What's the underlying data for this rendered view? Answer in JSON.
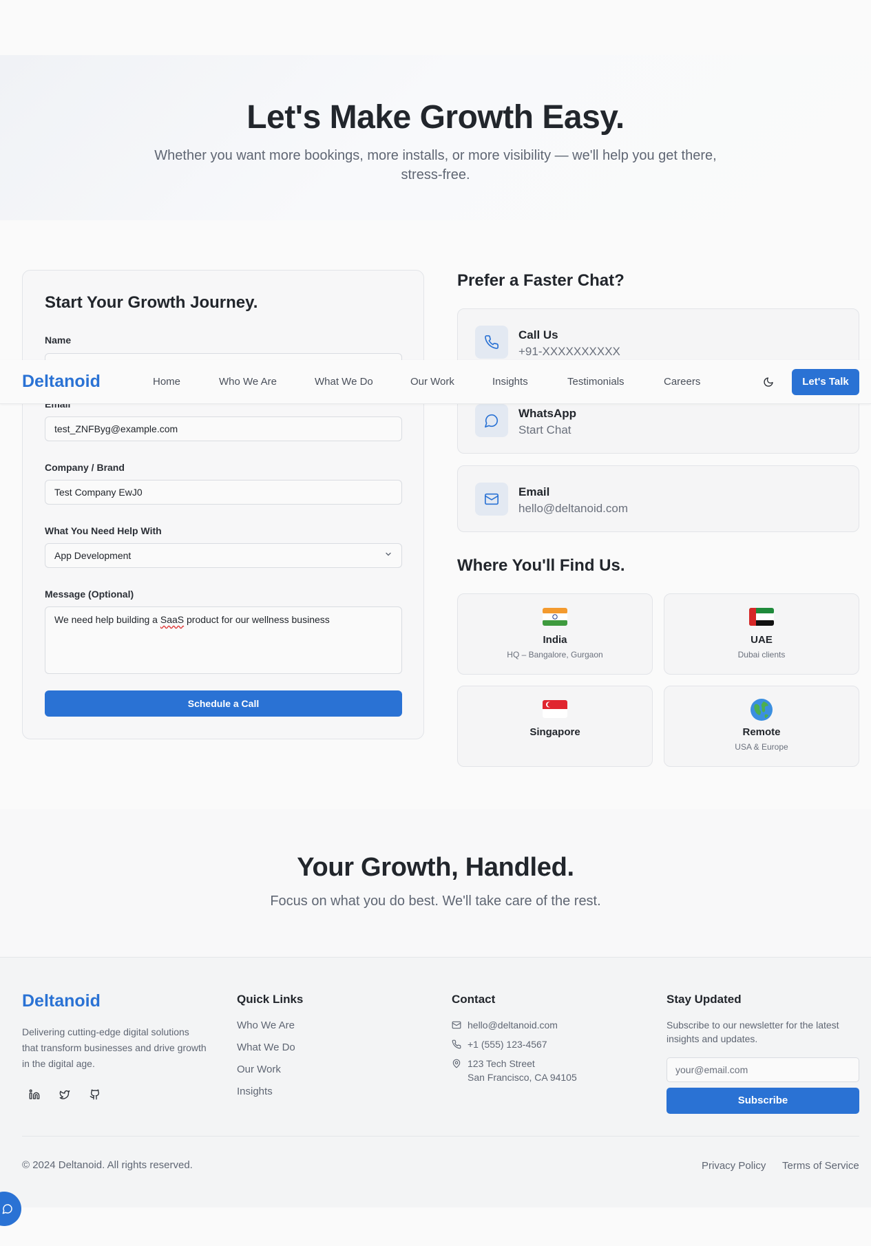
{
  "hero": {
    "title": "Let's Make Growth Easy.",
    "subtitle": "Whether you want more bookings, more installs, or more visibility — we'll help you get there, stress-free."
  },
  "form": {
    "title": "Start Your Growth Journey.",
    "name_label": "Name",
    "email_label": "Email",
    "email_value": "test_ZNFByg@example.com",
    "company_label": "Company / Brand",
    "company_value": "Test Company EwJ0",
    "help_label": "What You Need Help With",
    "help_value": "App Development",
    "message_label": "Message (Optional)",
    "message_prefix": "We need help building a ",
    "message_misspelled": "SaaS",
    "message_suffix": " product for our wellness business",
    "submit_label": "Schedule a Call"
  },
  "chat": {
    "title": "Prefer a Faster Chat?",
    "cards": [
      {
        "title": "Call Us",
        "value": "+91-XXXXXXXXXX",
        "icon": "phone-icon"
      },
      {
        "title": "WhatsApp",
        "value": "Start Chat",
        "icon": "chat-icon"
      },
      {
        "title": "Email",
        "value": "hello@deltanoid.com",
        "icon": "mail-icon"
      }
    ]
  },
  "locations": {
    "title": "Where You'll Find Us.",
    "items": [
      {
        "name": "India",
        "sub": "HQ – Bangalore, Gurgaon",
        "icon": "india-flag-icon"
      },
      {
        "name": "UAE",
        "sub": "Dubai clients",
        "icon": "uae-flag-icon"
      },
      {
        "name": "Singapore",
        "sub": "",
        "icon": "singapore-flag-icon"
      },
      {
        "name": "Remote",
        "sub": "USA & Europe",
        "icon": "globe-icon"
      }
    ]
  },
  "nav": {
    "brand": "Deltanoid",
    "links": [
      "Home",
      "Who We Are",
      "What We Do",
      "Our Work",
      "Insights",
      "Testimonials",
      "Careers"
    ],
    "cta": "Let's Talk"
  },
  "cta": {
    "title": "Your Growth, Handled.",
    "subtitle": "Focus on what you do best. We'll take care of the rest."
  },
  "footer": {
    "brand": "Deltanoid",
    "description": "Delivering cutting-edge digital solutions that transform businesses and drive growth in the digital age.",
    "quick_links_title": "Quick Links",
    "quick_links": [
      "Who We Are",
      "What We Do",
      "Our Work",
      "Insights"
    ],
    "contact_title": "Contact",
    "contact_email": "hello@deltanoid.com",
    "contact_phone": "+1 (555) 123-4567",
    "contact_address_line1": "123 Tech Street",
    "contact_address_line2": "San Francisco, CA 94105",
    "newsletter_title": "Stay Updated",
    "newsletter_desc": "Subscribe to our newsletter for the latest insights and updates.",
    "newsletter_placeholder": "your@email.com",
    "subscribe_label": "Subscribe",
    "copyright": "© 2024 Deltanoid. All rights reserved.",
    "privacy": "Privacy Policy",
    "terms": "Terms of Service"
  },
  "colors": {
    "accent": "#2a72d4",
    "text": "#22262c",
    "muted": "#5f6673",
    "background": "#fafafa"
  }
}
